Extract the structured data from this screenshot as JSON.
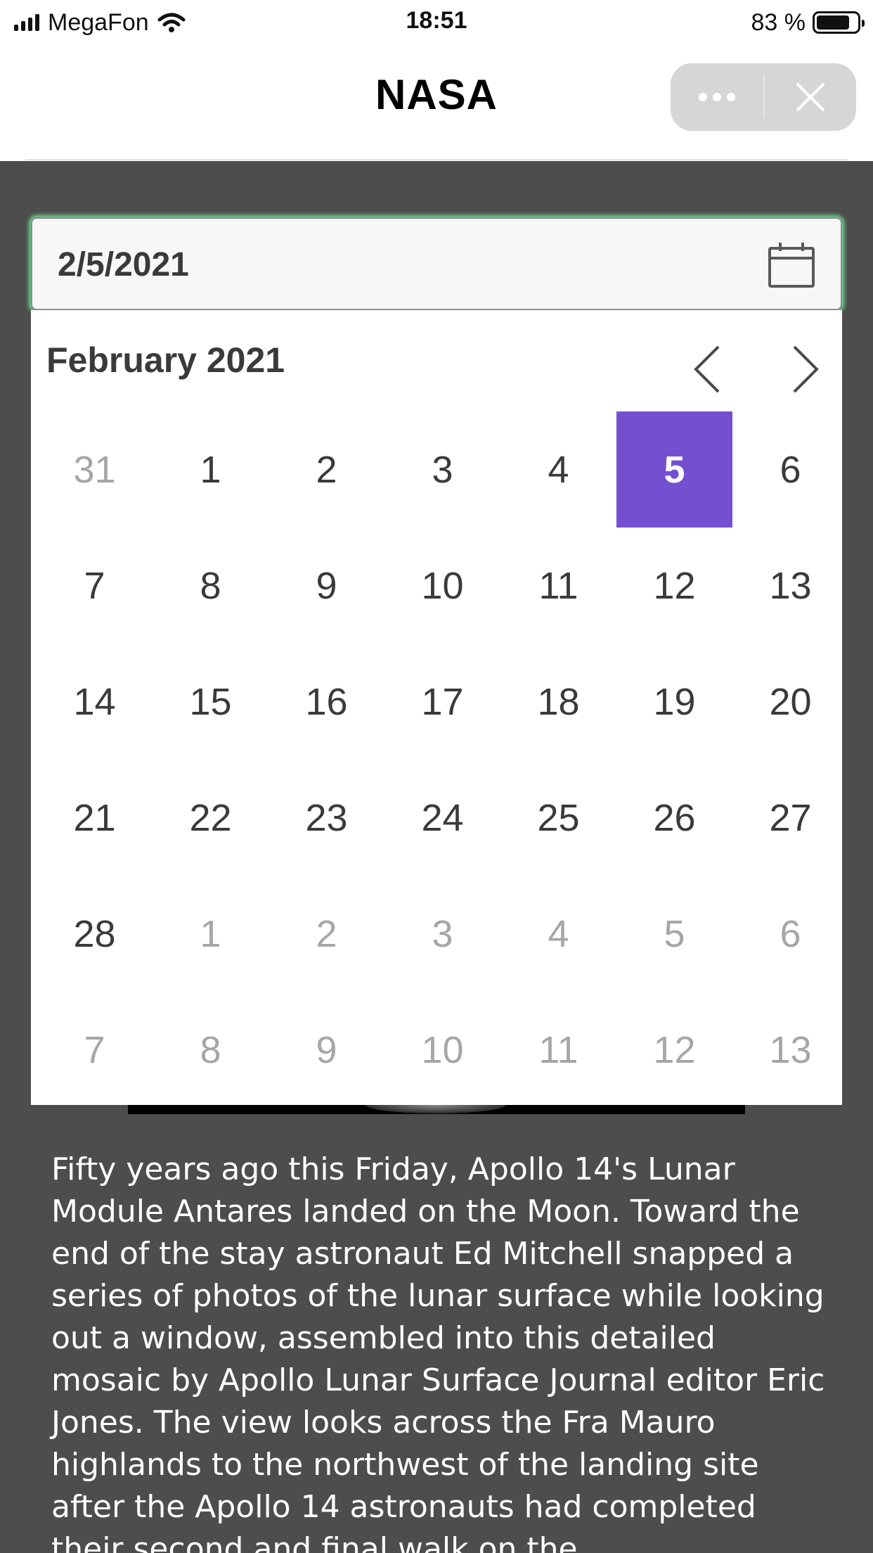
{
  "status_bar": {
    "carrier": "MegaFon",
    "time": "18:51",
    "battery": "83 %",
    "battery_level": 0.83
  },
  "nav": {
    "title": "NASA",
    "icons": [
      "more-icon",
      "close-icon"
    ]
  },
  "date_input": {
    "value": "2/5/2021",
    "icon": "calendar-icon",
    "focus_color": "#6fd98e"
  },
  "calendar": {
    "month_label": "February 2021",
    "prev_icon": "chevron-left-icon",
    "next_icon": "chevron-right-icon",
    "selected_color": "#7450d1",
    "selected_day": "5",
    "weeks": [
      [
        "31",
        "1",
        "2",
        "3",
        "4",
        "5",
        "6"
      ],
      [
        "7",
        "8",
        "9",
        "10",
        "11",
        "12",
        "13"
      ],
      [
        "14",
        "15",
        "16",
        "17",
        "18",
        "19",
        "20"
      ],
      [
        "21",
        "22",
        "23",
        "24",
        "25",
        "26",
        "27"
      ],
      [
        "28",
        "1",
        "2",
        "3",
        "4",
        "5",
        "6"
      ],
      [
        "7",
        "8",
        "9",
        "10",
        "11",
        "12",
        "13"
      ]
    ],
    "day_states": [
      [
        "muted",
        "",
        "",
        "",
        "",
        "selected",
        ""
      ],
      [
        "",
        "",
        "",
        "",
        "",
        "",
        ""
      ],
      [
        "",
        "",
        "",
        "",
        "",
        "",
        ""
      ],
      [
        "",
        "",
        "",
        "",
        "",
        "",
        ""
      ],
      [
        "",
        "muted",
        "muted",
        "muted",
        "muted",
        "muted",
        "muted"
      ],
      [
        "muted",
        "muted",
        "muted",
        "muted",
        "muted",
        "muted",
        "muted"
      ]
    ]
  },
  "content": {
    "description": "Fifty years ago this Friday, Apollo 14's Lunar Module Antares landed on the Moon. Toward the end of the stay astronaut Ed Mitchell snapped a series of photos of the lunar surface while looking out a window, assembled into this detailed mosaic by Apollo Lunar Surface Journal editor Eric Jones. The view looks across the Fra Mauro highlands to the northwest of the landing site after the Apollo 14 astronauts had completed their second and final walk on the"
  }
}
